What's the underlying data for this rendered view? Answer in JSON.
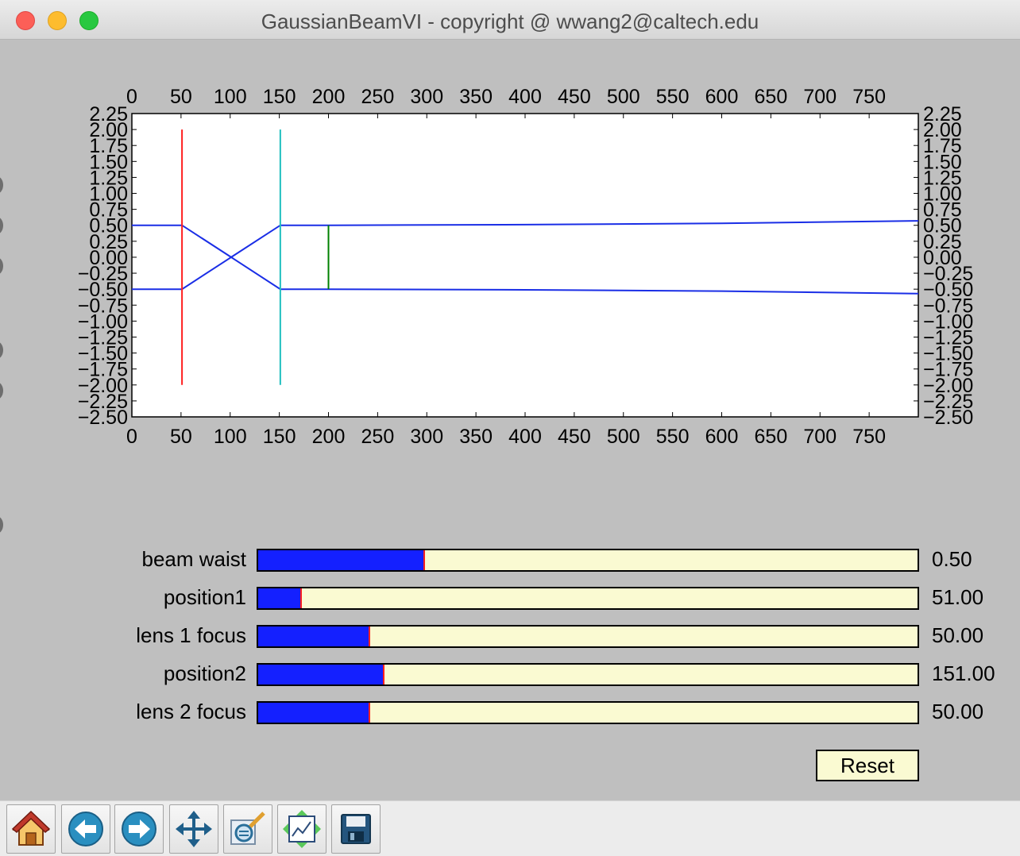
{
  "window": {
    "title": "GaussianBeamVI - copyright @ wwang2@caltech.edu"
  },
  "colors": {
    "background": "#bfbfbf",
    "slider_track": "#fafad2",
    "slider_fill": "#1420ff",
    "slider_marker": "#ff1f1f",
    "beam": "#1a2ee6",
    "lens1": "#ff2020",
    "lens2": "#1fbfbf",
    "waist_marker": "#008000"
  },
  "chart_data": {
    "type": "line",
    "xlim": [
      0,
      800
    ],
    "ylim": [
      -2.5,
      2.25
    ],
    "x_ticks": [
      "0",
      "50",
      "100",
      "150",
      "200",
      "250",
      "300",
      "350",
      "400",
      "450",
      "500",
      "550",
      "600",
      "650",
      "700",
      "750"
    ],
    "y_ticks": [
      "2.25",
      "2.00",
      "1.75",
      "1.50",
      "1.25",
      "1.00",
      "0.75",
      "0.50",
      "0.25",
      "0.00",
      "−0.25",
      "−0.50",
      "−0.75",
      "−1.00",
      "−1.25",
      "−1.50",
      "−1.75",
      "−2.00",
      "−2.25",
      "−2.50"
    ],
    "grid": false,
    "ticks_on_all_sides": true,
    "series": [
      {
        "color": "#1a2ee6",
        "x": [
          0,
          51,
          101,
          151,
          200,
          400,
          600,
          800
        ],
        "y": [
          0.5,
          0.5,
          0.0,
          0.5,
          0.5,
          0.51,
          0.53,
          0.57
        ]
      },
      {
        "color": "#1a2ee6",
        "x": [
          0,
          51,
          101,
          151,
          200,
          400,
          600,
          800
        ],
        "y": [
          -0.5,
          -0.5,
          0.0,
          -0.5,
          -0.5,
          -0.51,
          -0.53,
          -0.57
        ]
      }
    ],
    "vlines": [
      {
        "color": "#ff2020",
        "x": 51,
        "y0": -2.0,
        "y1": 2.0
      },
      {
        "color": "#1fbfbf",
        "x": 151,
        "y0": -2.0,
        "y1": 2.0
      },
      {
        "color": "#008000",
        "x": 200,
        "y0": -0.5,
        "y1": 0.5
      }
    ]
  },
  "sliders": [
    {
      "label": "beam waist",
      "value": "0.50",
      "fraction": 0.25
    },
    {
      "label": "position1",
      "value": "51.00",
      "fraction": 0.0638
    },
    {
      "label": "lens 1 focus",
      "value": "50.00",
      "fraction": 0.167
    },
    {
      "label": "position2",
      "value": "151.00",
      "fraction": 0.189
    },
    {
      "label": "lens 2 focus",
      "value": "50.00",
      "fraction": 0.167
    }
  ],
  "reset_label": "Reset",
  "toolbar": {
    "buttons": [
      {
        "icon": "home-icon"
      },
      {
        "icon": "back-arrow-icon"
      },
      {
        "icon": "forward-arrow-icon"
      },
      {
        "icon": "pan-move-icon"
      },
      {
        "icon": "zoom-rect-icon"
      },
      {
        "icon": "subplots-config-icon"
      },
      {
        "icon": "save-disk-icon"
      }
    ]
  }
}
